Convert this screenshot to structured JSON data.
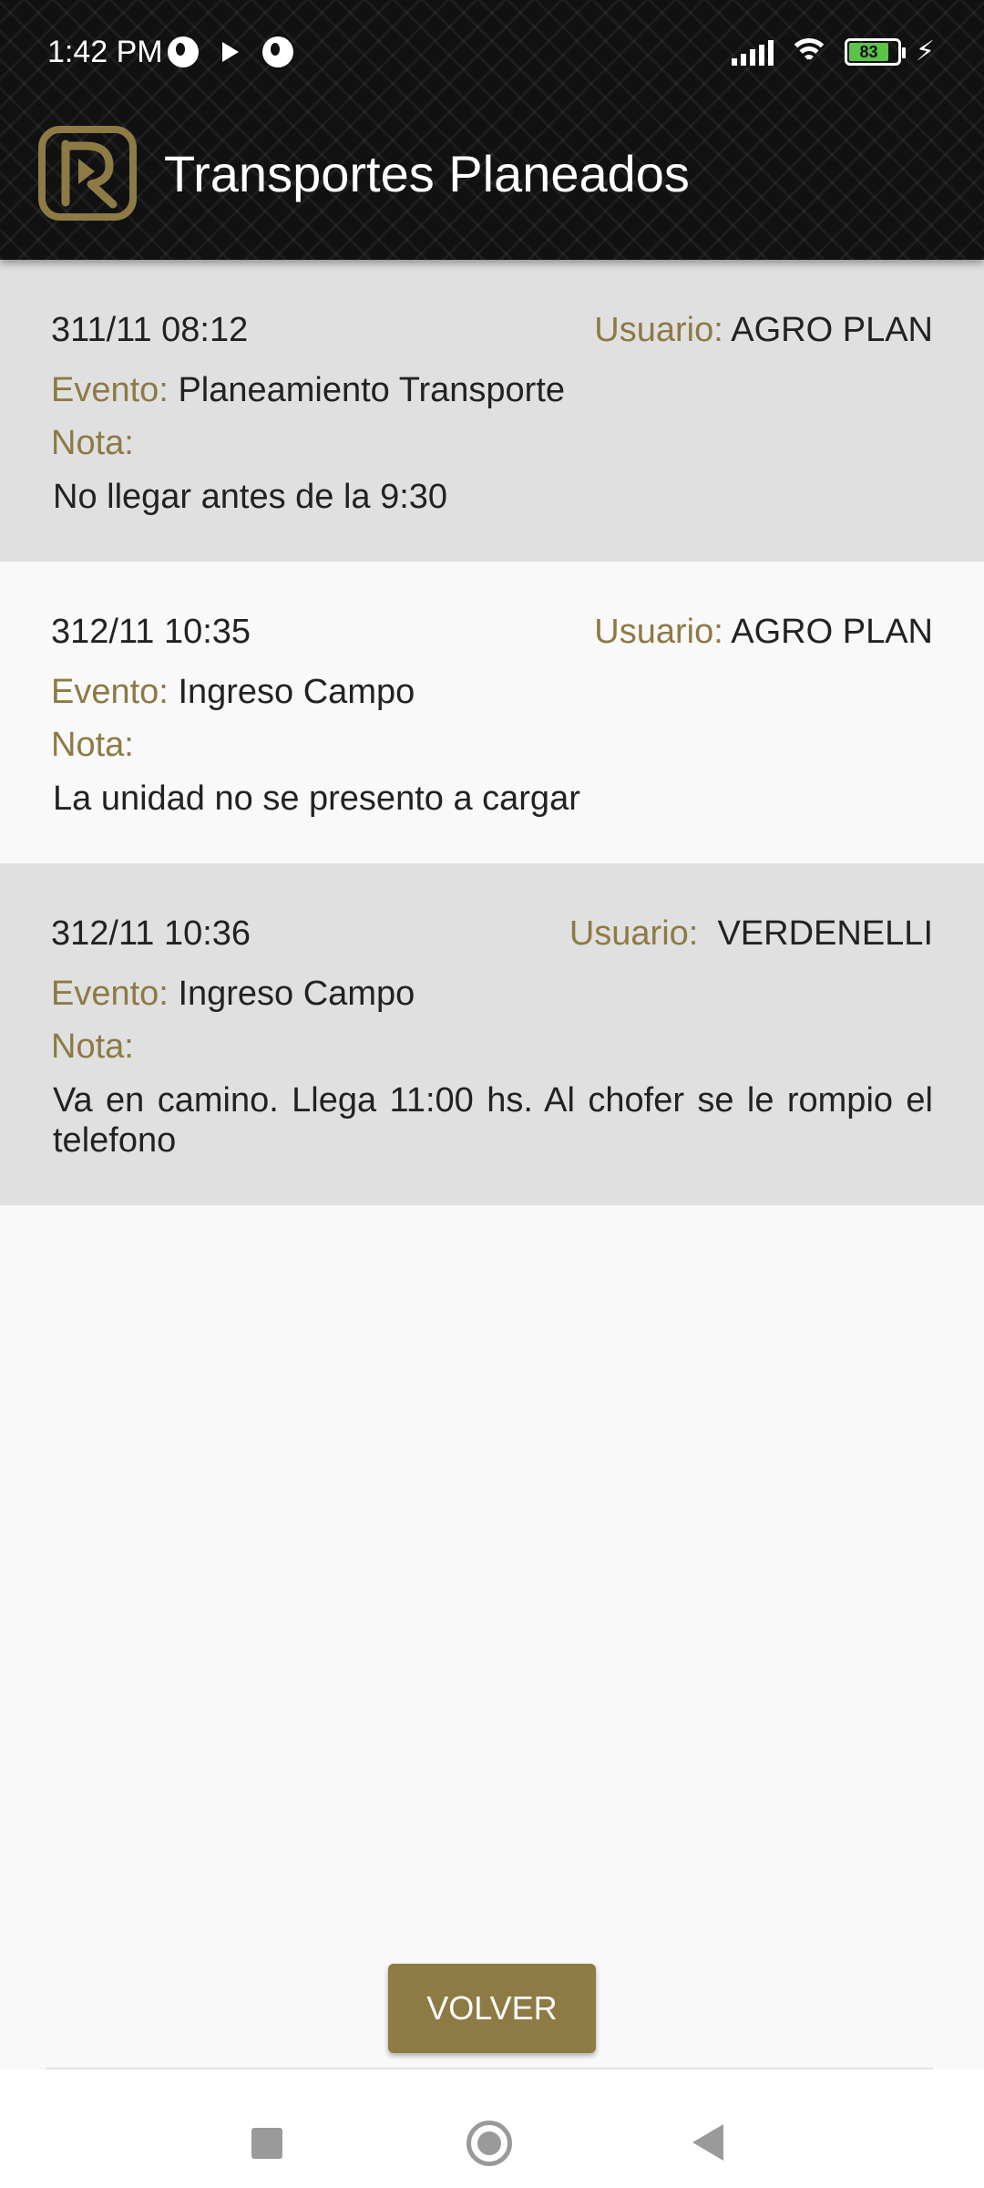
{
  "status_bar": {
    "time": "1:42 PM",
    "battery_level": "83",
    "icons": [
      "notification-icon",
      "play-store-icon",
      "notification-icon",
      "signal-icon",
      "wifi-icon",
      "battery-icon",
      "charging-icon"
    ]
  },
  "header": {
    "title": "Transportes Planeados",
    "logo_icon": "app-logo-icon"
  },
  "labels": {
    "user": "Usuario:",
    "event": "Evento:",
    "note": "Nota:"
  },
  "events": [
    {
      "date": "311/11 08:12",
      "user": "AGRO PLAN",
      "event": "Planeamiento Transporte",
      "note": "No llegar antes de la 9:30"
    },
    {
      "date": "312/11 10:35",
      "user": "AGRO PLAN",
      "event": "Ingreso Campo",
      "note": "La unidad no se presento a cargar"
    },
    {
      "date": "312/11 10:36",
      "user": " VERDENELLI",
      "event": "Ingreso Campo",
      "note": "Va en camino. Llega 11:00 hs. Al chofer se le rompio el telefono"
    }
  ],
  "footer": {
    "back_button": "VOLVER"
  },
  "colors": {
    "accent": "#8d7a44",
    "row_shaded": "#e0e0e0",
    "row_plain": "#f9f9f9",
    "appbar": "#111111"
  }
}
